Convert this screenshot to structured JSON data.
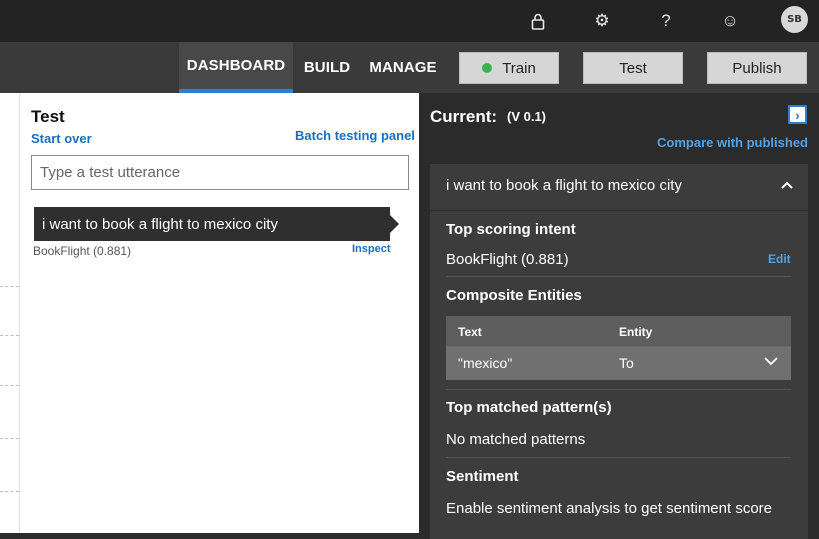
{
  "topbar": {
    "icons": [
      "lock-icon",
      "gear-icon",
      "help-icon",
      "smiley-icon"
    ],
    "avatar_initials": "SB"
  },
  "nav": {
    "tabs": [
      "DASHBOARD",
      "BUILD",
      "MANAGE"
    ],
    "active_tab": "DASHBOARD",
    "train_label": "Train",
    "test_label": "Test",
    "publish_label": "Publish"
  },
  "test_panel": {
    "title": "Test",
    "start_over": "Start over",
    "batch_link": "Batch testing panel",
    "input_placeholder": "Type a test utterance",
    "utterance": "i want to book a flight to mexico city",
    "utterance_intent": "BookFlight (0.881)",
    "inspect_label": "Inspect"
  },
  "inspect_panel": {
    "current_label": "Current:",
    "version": "(V 0.1)",
    "compare_link": "Compare with published",
    "utterance": "i want to book a flight to mexico city",
    "top_intent_title": "Top scoring intent",
    "top_intent_value": "BookFlight (0.881)",
    "edit_label": "Edit",
    "composite_title": "Composite Entities",
    "table": {
      "headers": [
        "Text",
        "Entity"
      ],
      "rows": [
        {
          "text": "\"mexico\"",
          "entity": "To"
        }
      ]
    },
    "patterns_title": "Top matched pattern(s)",
    "patterns_value": "No matched patterns",
    "sentiment_title": "Sentiment",
    "sentiment_value": "Enable sentiment analysis to get sentiment score"
  },
  "colors": {
    "accent": "#2f7fd1",
    "link_light": "#1a6fc0",
    "link_dark": "#4fa3ea",
    "train_dot": "#3bb34a"
  }
}
